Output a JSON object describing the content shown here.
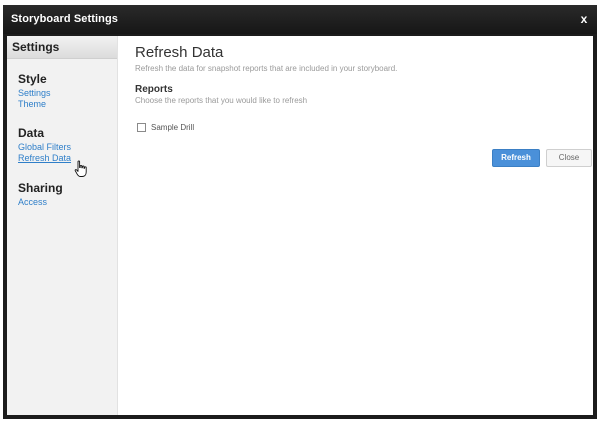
{
  "window": {
    "title": "Storyboard Settings",
    "close_glyph": "x"
  },
  "sidebar": {
    "header": "Settings",
    "sections": [
      {
        "label": "Style",
        "links": [
          "Settings",
          "Theme"
        ]
      },
      {
        "label": "Data",
        "links": [
          "Global Filters",
          "Refresh Data"
        ]
      },
      {
        "label": "Sharing",
        "links": [
          "Access"
        ]
      }
    ],
    "active_link": "Refresh Data"
  },
  "main": {
    "title": "Refresh Data",
    "description": "Refresh the data for snapshot reports that are included in your storyboard.",
    "reports_heading": "Reports",
    "reports_hint": "Choose the reports that you would like to refresh",
    "reports": [
      {
        "label": "Sample Drill",
        "checked": false
      }
    ],
    "refresh_label": "Refresh",
    "close_label": "Close"
  },
  "colors": {
    "accent": "#4a90d9",
    "link": "#2f7fc9",
    "titlebar": "#1c1c1c"
  },
  "icons": {
    "close": "close-icon",
    "pointer": "hand-pointer-icon"
  }
}
